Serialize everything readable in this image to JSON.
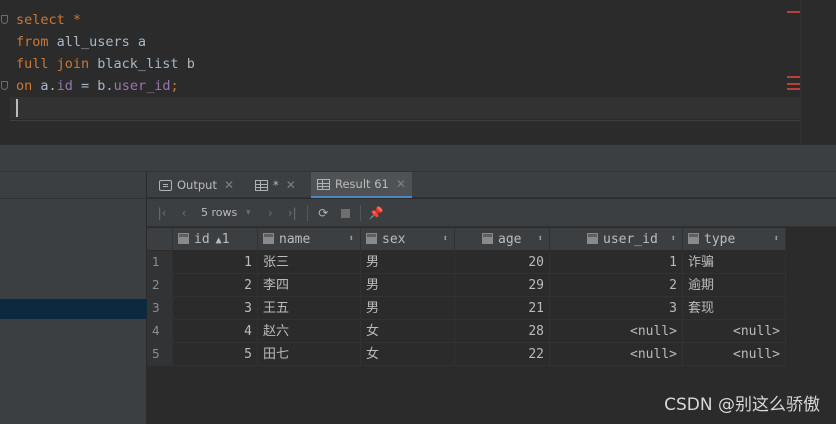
{
  "editor": {
    "lines": [
      [
        {
          "t": "kw",
          "v": "select"
        },
        {
          "t": "id",
          "v": " "
        },
        {
          "t": "kw",
          "v": "*"
        }
      ],
      [
        {
          "t": "kw",
          "v": "from"
        },
        {
          "t": "id",
          "v": " all_users a"
        }
      ],
      [
        {
          "t": "kw",
          "v": "full join"
        },
        {
          "t": "id",
          "v": " black_list b"
        }
      ],
      [
        {
          "t": "kw",
          "v": "on"
        },
        {
          "t": "id",
          "v": " a."
        },
        {
          "t": "fld",
          "v": "id"
        },
        {
          "t": "id",
          "v": " = b."
        },
        {
          "t": "fld",
          "v": "user_id"
        },
        {
          "t": "kw",
          "v": ";"
        }
      ]
    ]
  },
  "tabs": [
    {
      "label": "Output",
      "icon": "output-icon",
      "closable": true
    },
    {
      "label": "*",
      "icon": "table-icon",
      "closable": true
    },
    {
      "label": "Result 61",
      "icon": "table-icon",
      "closable": true,
      "active": true
    }
  ],
  "toolbar": {
    "rows_label": "5 rows",
    "first_icon": "first-page-icon",
    "prev_icon": "prev-page-icon",
    "next_icon": "next-page-icon",
    "last_icon": "last-page-icon",
    "refresh_icon": "refresh-icon",
    "stop_icon": "stop-icon",
    "pin_icon": "pin-icon"
  },
  "table": {
    "columns": [
      "id",
      "name",
      "sex",
      "age",
      "user_id",
      "type"
    ],
    "sort_indicator": "1",
    "rows": [
      [
        "1",
        "1",
        "张三",
        "男",
        "20",
        "1",
        "诈骗"
      ],
      [
        "2",
        "2",
        "李四",
        "男",
        "29",
        "2",
        "逾期"
      ],
      [
        "3",
        "3",
        "王五",
        "男",
        "21",
        "3",
        "套现"
      ],
      [
        "4",
        "4",
        "赵六",
        "女",
        "28",
        "<null>",
        "<null>"
      ],
      [
        "5",
        "5",
        "田七",
        "女",
        "22",
        "<null>",
        "<null>"
      ]
    ]
  },
  "watermark": "CSDN @别这么骄傲",
  "colors": {
    "keyword": "#cc7832",
    "field": "#9876aa",
    "null": "#3ea62f",
    "active_tab_underline": "#4a88c7"
  }
}
